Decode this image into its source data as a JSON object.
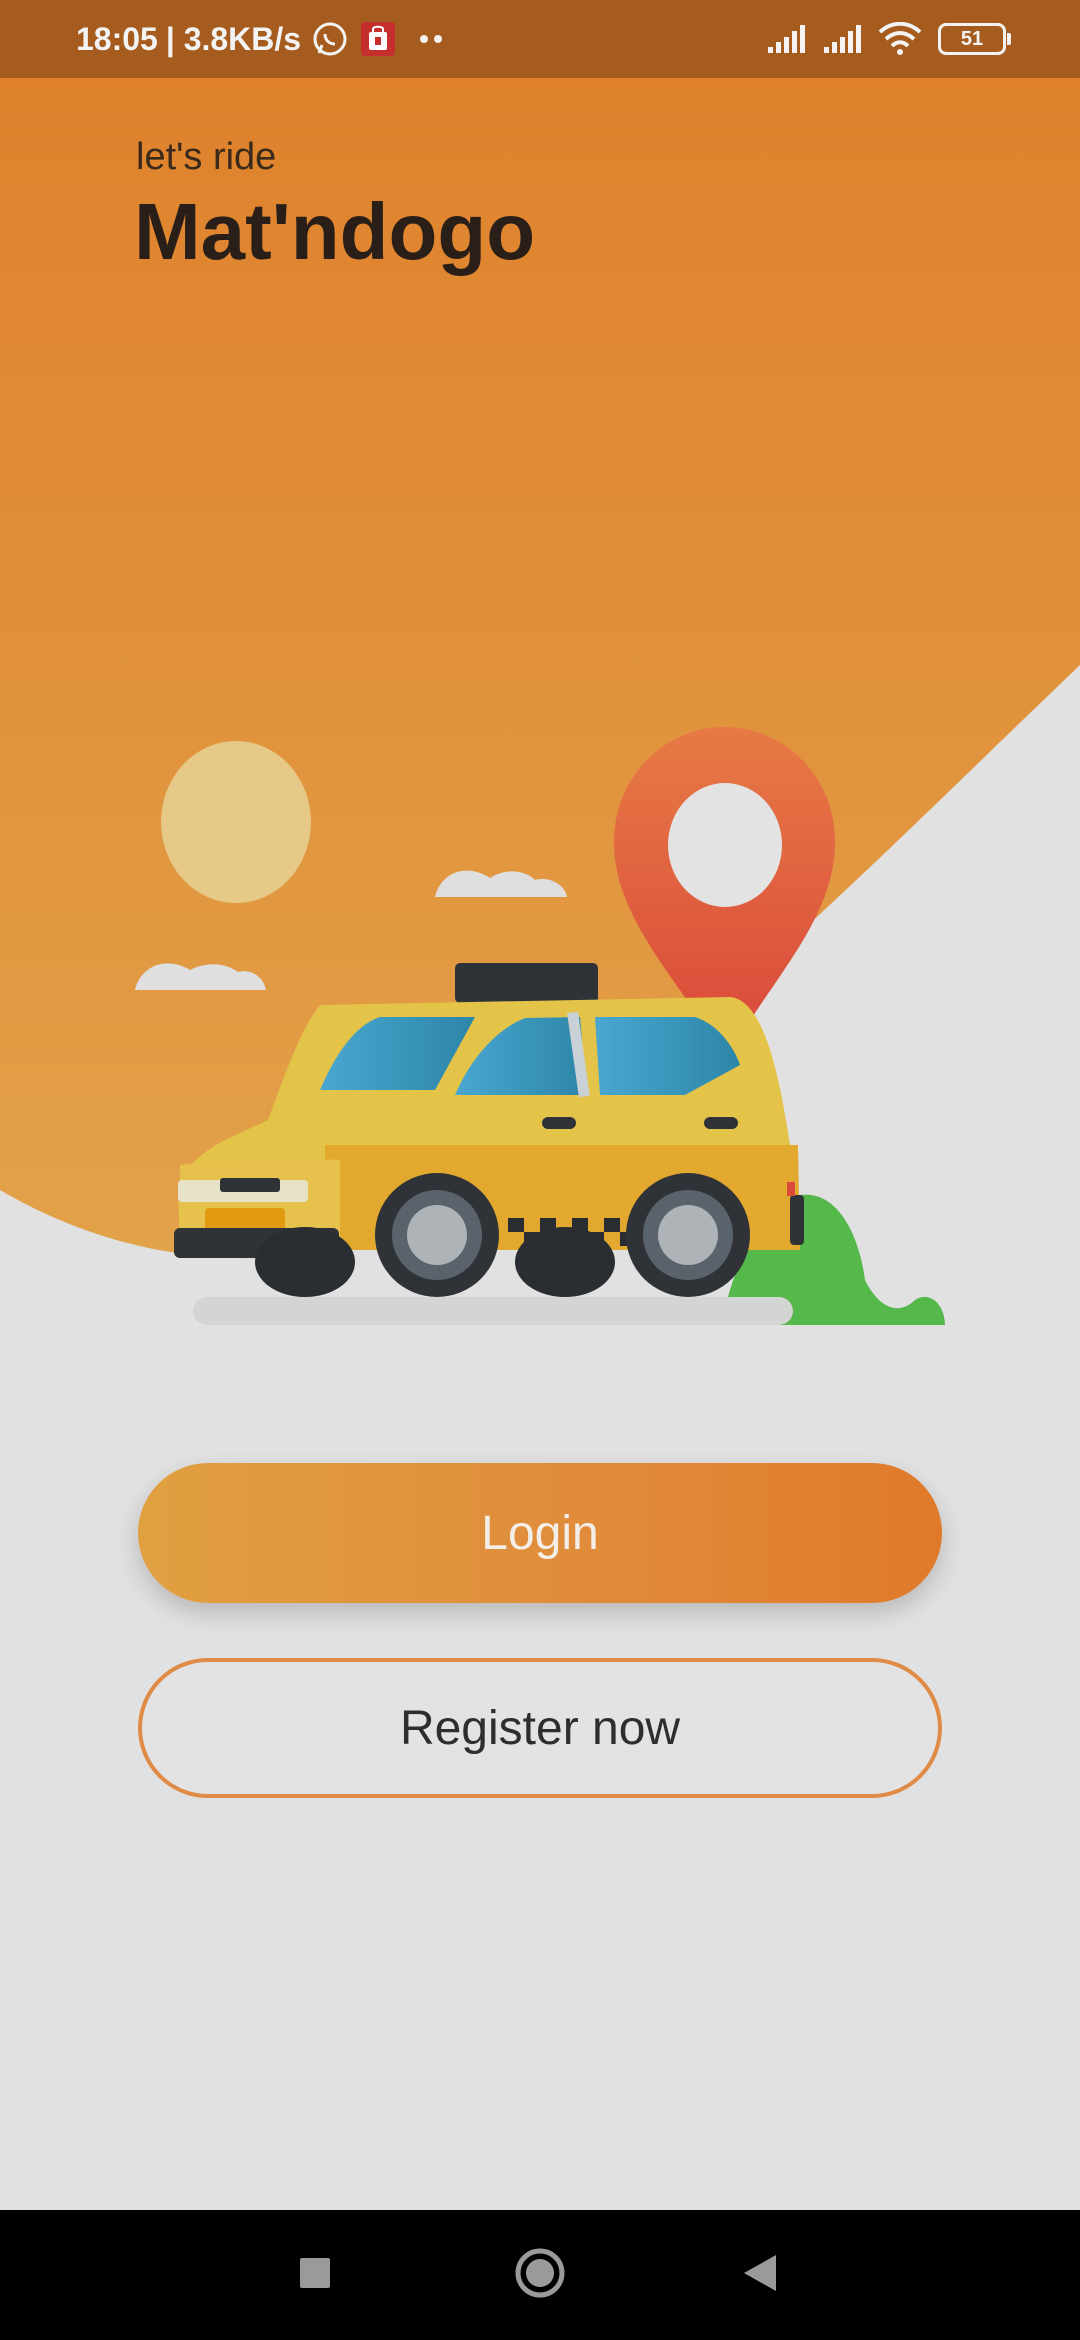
{
  "status_bar": {
    "time": "18:05",
    "speed": "| 3.8KB/s",
    "battery": "51",
    "icons": [
      "whatsapp-icon",
      "shopping-bag-icon",
      "more-dots-icon",
      "signal-icon",
      "signal-icon",
      "wifi-icon",
      "battery-icon"
    ]
  },
  "hero": {
    "subtitle": "let's ride",
    "title": "Mat'ndogo"
  },
  "actions": {
    "login_label": "Login",
    "register_label": "Register now"
  },
  "nav": {
    "icons": [
      "recents-square-icon",
      "home-circle-icon",
      "back-triangle-icon"
    ]
  },
  "colors": {
    "accent_orange": "#df7f2a",
    "hero_light": "#e0a04a",
    "status_bar": "#a65c1e",
    "background": "#e1e1e1",
    "taxi_yellow": "#e4b13b",
    "pin_red": "#e05e3a",
    "bush_green": "#55b84a"
  }
}
